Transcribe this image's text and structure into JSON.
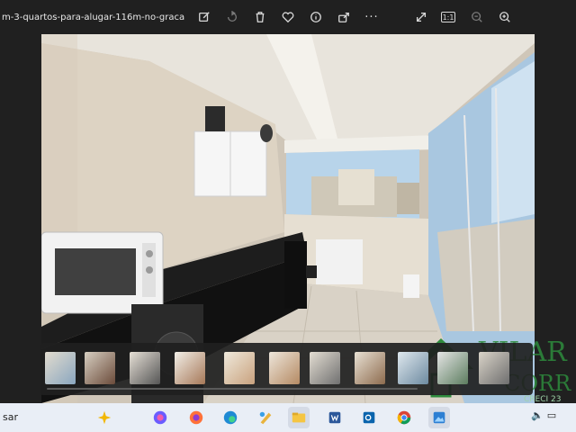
{
  "window": {
    "title": "m-3-quartos-para-alugar-116m-no-graca-..."
  },
  "toolbar": {
    "icons": [
      "edit-icon",
      "rotate-icon",
      "delete-icon",
      "favorite-icon",
      "info-icon",
      "share-icon",
      "more-icon",
      "expand-icon",
      "actual-size-icon",
      "zoom-out-icon",
      "zoom-in-icon"
    ],
    "more_label": "···",
    "actual_size_label": "1:1"
  },
  "watermark": {
    "brand_line1": "VILAR",
    "brand_line2": "CORR",
    "creci": "CRECI 23"
  },
  "filmstrip": {
    "thumbnail_count": 11
  },
  "taskbar": {
    "search_text": "sar",
    "apps": [
      "copilot-icon",
      "firefox-icon",
      "edge-icon",
      "paint-icon",
      "file-explorer-icon",
      "word-icon",
      "outlook-icon",
      "chrome-icon",
      "photos-icon"
    ]
  }
}
